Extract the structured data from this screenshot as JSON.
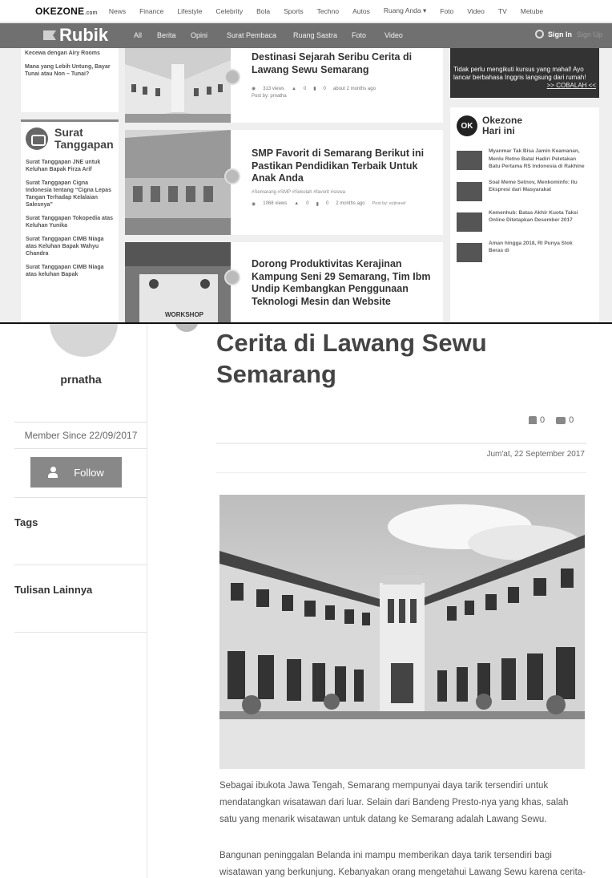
{
  "top_nav": {
    "logo": "OKEZONE",
    "logo_suffix": ".com",
    "items": [
      "News",
      "Finance",
      "Lifestyle",
      "Celebrity",
      "Bola",
      "Sports",
      "Techno",
      "Autos",
      "Ruang Anda ▾",
      "Foto",
      "Video",
      "TV",
      "Metube"
    ]
  },
  "rubik_bar": {
    "logo": "Rubik",
    "items": [
      "All",
      "Berita",
      "Opini",
      "Surat Pembaca",
      "Ruang Sastra",
      "Foto",
      "Video"
    ],
    "sign_in": "Sign In",
    "sign_up": "Sign Up"
  },
  "left_column": {
    "top_items": [
      "Kecewa dengan Airy Rooms",
      "Mana yang Lebih Untung, Bayar Tunai atau Non – Tunai?"
    ],
    "surat": {
      "title_line1": "Surat",
      "title_line2": "Tanggapan",
      "items": [
        "Surat Tanggapan JNE untuk Keluhan Bapak Firza Arif",
        "Surat Tanggapan Cigna Indonesia tentang “Cigna Lepas Tangan Terhadap Kelalaian Salesnya”",
        "Surat Tanggapan Tokopedia atas Keluhan Yunika",
        "Surat Tanggapan CIMB Niaga atas Keluhan Bapak Wahyu Chandra",
        "Surat Tanggapan CIMB Niaga atas keluhan Bapak"
      ]
    }
  },
  "articles": [
    {
      "title": "Destinasi Sejarah Seribu Cerita di Lawang Sewu Semarang",
      "views": "313 views",
      "likes": "0",
      "comments": "0",
      "time": "about 2 months ago",
      "posted_by": "Post by: prnatha"
    },
    {
      "title": "SMP Favorit di Semarang Berikut ini Pastikan Pendidikan Terbaik Untuk Anak Anda",
      "tags": "#Semarang #SMP #Sekolah #favorit #siswa",
      "views": "1068 views",
      "likes": "0",
      "comments": "0",
      "time": "2 months ago",
      "posted_by": "Post by: ezjtravel"
    },
    {
      "title": "Dorong Produktivitas Kerajinan Kampung Seni 29 Semarang, Tim Ibm Undip Kembangkan Penggunaan Teknologi Mesin dan Website",
      "thumb_caption": "WORKSHOP"
    }
  ],
  "ad": {
    "text": "Tidak perlu mengikuti kursus yang mahal! Ayo lancar berbahasa Inggris langsung dari rumah!",
    "cta": ">> COBALAH <<"
  },
  "okezone_hari_ini": {
    "badge": "OK",
    "title_line1": "Okezone",
    "title_line2": "Hari ini",
    "items": [
      "Myanmar Tak Bisa Jamin Keamanan, Menlu Retno Batal Hadiri Peletakan Batu Pertama RS Indonesia di Rakhine",
      "Soal Meme Setnov, Menkominfo: Itu Ekspresi dari Masyarakat",
      "Kemenhub: Batas Akhir Kuota Taksi Online Ditetapkan Desember 2017",
      "Aman hingga 2018, RI Punya Stok Beras di"
    ]
  },
  "profile": {
    "username": "prnatha",
    "member_since": "Member Since 22/09/2017",
    "follow_label": "Follow",
    "tags_heading": "Tags",
    "others_heading": "Tulisan Lainnya"
  },
  "article": {
    "title": "Cerita di Lawang Sewu Semarang",
    "likes": "0",
    "comments": "0",
    "date": "Jum'at, 22 September 2017",
    "paragraph1": "Sebagai ibukota Jawa Tengah, Semarang mempunyai daya tarik tersendiri untuk mendatangkan wisatawan dari luar. Selain dari Bandeng Presto-nya yang khas, salah satu yang menarik wisatawan untuk datang ke Semarang adalah Lawang Sewu.",
    "paragraph2": "Bangunan peninggalan Belanda ini mampu memberikan daya tarik tersendiri bagi wisatawan yang berkunjung. Kebanyakan orang mengetahui Lawang Sewu karena cerita-"
  }
}
